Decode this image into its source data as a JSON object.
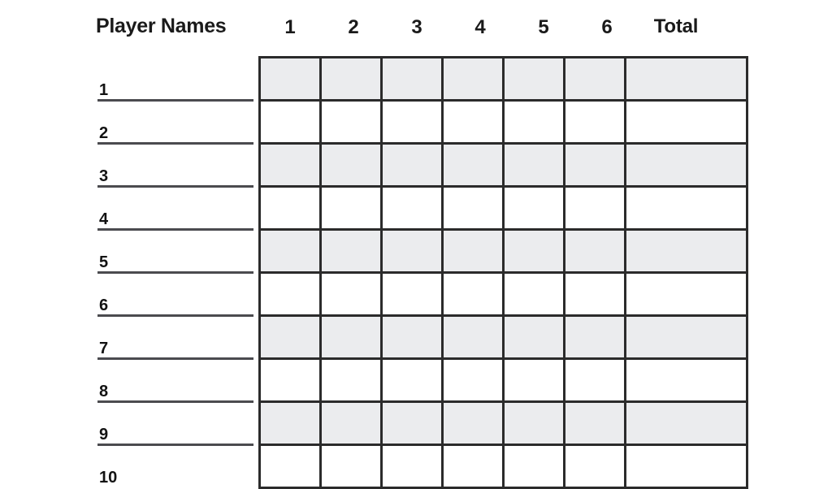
{
  "sheet": {
    "title": "Player Names",
    "round_headers": [
      "1",
      "2",
      "3",
      "4",
      "5",
      "6"
    ],
    "total_header": "Total",
    "row_numbers": [
      "1",
      "2",
      "3",
      "4",
      "5",
      "6",
      "7",
      "8",
      "9",
      "10"
    ],
    "colors": {
      "shaded_row": "#ebecee",
      "unshaded_row": "#ffffff",
      "grid_line": "#2b2b2b",
      "name_line": "#4b4b4f",
      "text": "#1a1a1a",
      "background": "#ffffff"
    },
    "rows": [
      {
        "number": "1",
        "player_name": "",
        "scores": [
          "",
          "",
          "",
          "",
          "",
          ""
        ],
        "total": "",
        "shaded": true
      },
      {
        "number": "2",
        "player_name": "",
        "scores": [
          "",
          "",
          "",
          "",
          "",
          ""
        ],
        "total": "",
        "shaded": false
      },
      {
        "number": "3",
        "player_name": "",
        "scores": [
          "",
          "",
          "",
          "",
          "",
          ""
        ],
        "total": "",
        "shaded": true
      },
      {
        "number": "4",
        "player_name": "",
        "scores": [
          "",
          "",
          "",
          "",
          "",
          ""
        ],
        "total": "",
        "shaded": false
      },
      {
        "number": "5",
        "player_name": "",
        "scores": [
          "",
          "",
          "",
          "",
          "",
          ""
        ],
        "total": "",
        "shaded": true
      },
      {
        "number": "6",
        "player_name": "",
        "scores": [
          "",
          "",
          "",
          "",
          "",
          ""
        ],
        "total": "",
        "shaded": false
      },
      {
        "number": "7",
        "player_name": "",
        "scores": [
          "",
          "",
          "",
          "",
          "",
          ""
        ],
        "total": "",
        "shaded": true
      },
      {
        "number": "8",
        "player_name": "",
        "scores": [
          "",
          "",
          "",
          "",
          "",
          ""
        ],
        "total": "",
        "shaded": false
      },
      {
        "number": "9",
        "player_name": "",
        "scores": [
          "",
          "",
          "",
          "",
          "",
          ""
        ],
        "total": "",
        "shaded": true
      },
      {
        "number": "10",
        "player_name": "",
        "scores": [
          "",
          "",
          "",
          "",
          "",
          ""
        ],
        "total": "",
        "shaded": false
      }
    ]
  }
}
